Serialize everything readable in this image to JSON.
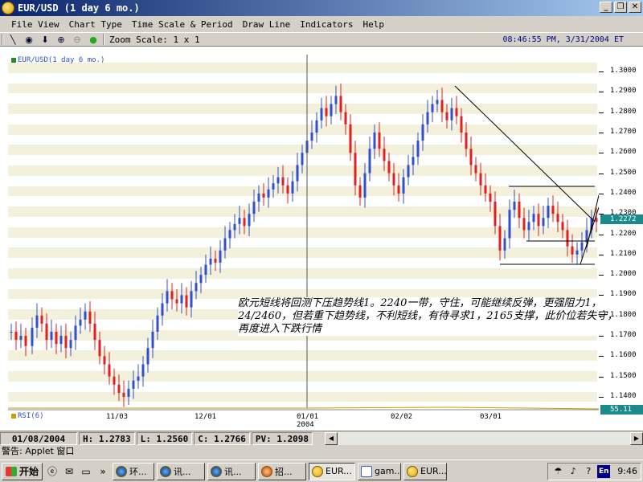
{
  "window": {
    "title": "EUR/USD (1 day  6 mo.)"
  },
  "menu": [
    "File View",
    "Chart Type",
    "Time Scale & Period",
    "Draw Line",
    "Indicators",
    "Help"
  ],
  "toolbar": {
    "icons": [
      "draw-line-icon",
      "target-icon",
      "down-arrow-icon",
      "zoom-in-icon",
      "zoom-out-icon",
      "green-dot-icon"
    ],
    "zoom_label": "Zoom Scale: 1 x 1",
    "datetime": "08:46:55 PM, 3/31/2004 ET"
  },
  "chart": {
    "legend": "EUR/USD(1 day  6 mo.)",
    "rsi_legend": "RSI(6)",
    "price_labels": [
      "1.3000",
      "1.2900",
      "1.2800",
      "1.2700",
      "1.2600",
      "1.2500",
      "1.2400",
      "1.2300",
      "1.2200",
      "1.2100",
      "1.2000",
      "1.1900",
      "1.1800",
      "1.1700",
      "1.1600",
      "1.1500",
      "1.1400"
    ],
    "current_price": "1.2272",
    "rsi_value": "55.11",
    "date_labels": [
      "11/03",
      "12/01",
      "01/01",
      "02/02",
      "03/01"
    ],
    "year_label": "2004",
    "annotation": "欧元短线将回测下压趋势线1。2240一带，守住，可能继续反弹，更强阻力1，24/2460，但若重下趋势线，不利短线，有待寻求1，2165支撑，此价位若失守，再度进入下跌行情",
    "colors": {
      "up": "#3050d0",
      "down": "#e02020",
      "stripe": "#f3f0dc",
      "tag": "#1a8a8a"
    }
  },
  "chart_data": {
    "type": "candlestick",
    "ylim": [
      1.135,
      1.305
    ],
    "x_tick_labels": [
      "11/03",
      "12/01",
      "01/01",
      "02/02",
      "03/01"
    ],
    "last_close": 1.2272
  },
  "info": {
    "date": "01/08/2004",
    "high": "H: 1.2783",
    "low": "L: 1.2560",
    "close": "C: 1.2766",
    "pv": "PV: 1.2098"
  },
  "status": "警告: Applet 窗口",
  "taskbar": {
    "start": "开始",
    "buttons": [
      "环...",
      "讯...",
      "讯...",
      "招...",
      "EUR...",
      "gam...",
      "EUR..."
    ],
    "clock": "9:46",
    "ime": "En"
  }
}
